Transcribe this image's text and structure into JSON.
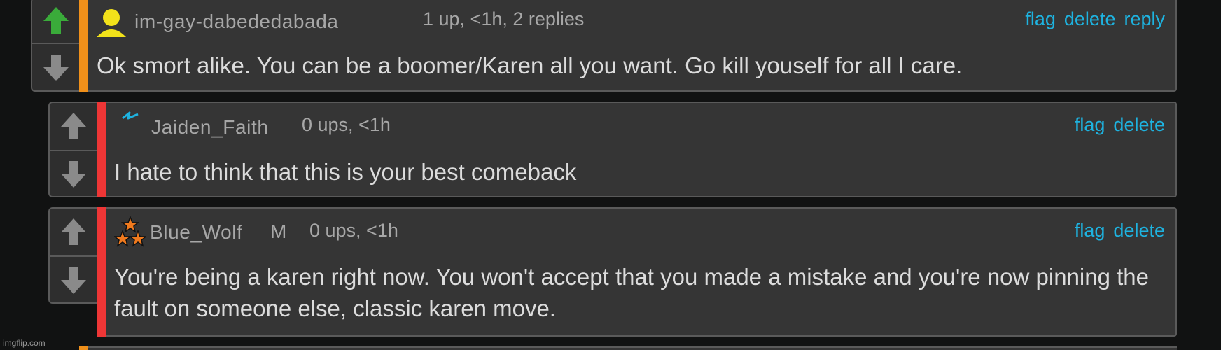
{
  "comments": [
    {
      "username": "im-gay-dabededabada",
      "badge": "",
      "meta": "1 up, <1h, 2 replies",
      "actions": [
        "flag",
        "delete",
        "reply"
      ],
      "text": "Ok smort alike. You can be a boomer/Karen all you want. Go kill youself for all I care.",
      "upvoted": true,
      "bar_color": "#f0901a",
      "icon": "user-silhouette-icon"
    },
    {
      "username": "Jaiden_Faith",
      "badge": "",
      "meta": "0 ups, <1h",
      "actions": [
        "flag",
        "delete"
      ],
      "text": "I hate to think that this is your best comeback",
      "upvoted": false,
      "bar_color": "#ee3636",
      "icon": "lightning-bolt-icon"
    },
    {
      "username": "Blue_Wolf",
      "badge": "M",
      "meta": "0 ups, <1h",
      "actions": [
        "flag",
        "delete"
      ],
      "text": "You're being a karen right now. You won't accept that you made a mistake and you're now pinning the fault on someone else, classic karen move.",
      "upvoted": false,
      "bar_color": "#ee3636",
      "icon": "three-stars-icon"
    }
  ],
  "colors": {
    "upvote_active": "#3aab3a",
    "vote_inactive": "#8a8a8a",
    "link": "#1eb3e0",
    "icon_yellow": "#f2e21a",
    "icon_blue": "#1eb3e0",
    "star_orange": "#f07a1e"
  },
  "watermark": "imgflip.com"
}
